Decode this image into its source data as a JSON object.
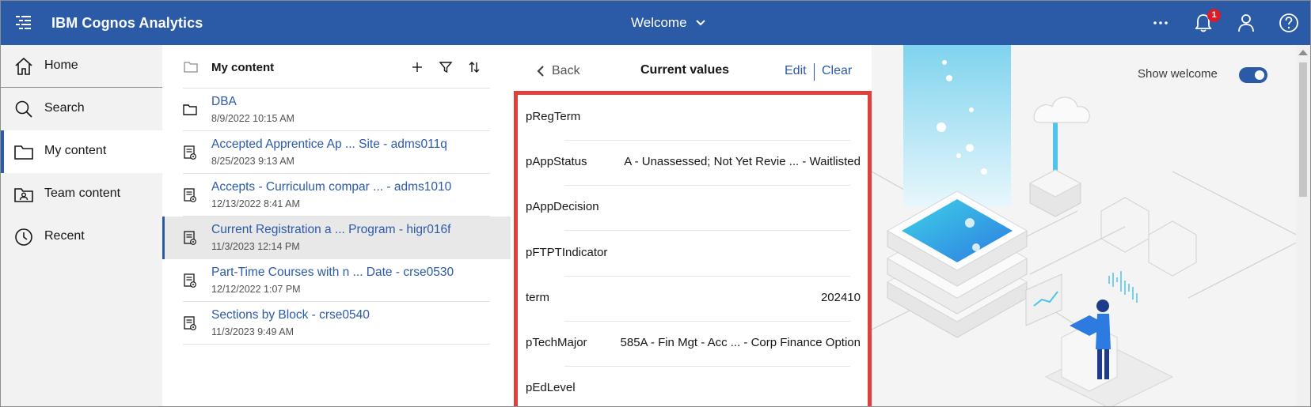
{
  "header": {
    "app_title": "IBM Cognos Analytics",
    "welcome_label": "Welcome",
    "notification_count": "1",
    "brand_color": "#2b5aa6"
  },
  "sidebar": {
    "items": [
      {
        "label": "Home",
        "icon": "home-icon"
      },
      {
        "label": "Search",
        "icon": "search-icon"
      },
      {
        "label": "My content",
        "icon": "folder-icon",
        "active": true
      },
      {
        "label": "Team content",
        "icon": "team-folder-icon"
      },
      {
        "label": "Recent",
        "icon": "clock-icon"
      }
    ]
  },
  "content": {
    "title": "My content",
    "items": [
      {
        "name": "DBA",
        "date": "8/9/2022 10:15 AM",
        "type": "folder"
      },
      {
        "name": "Accepted Apprentice Ap ... Site - adms011q",
        "date": "8/25/2023 9:13 AM",
        "type": "report"
      },
      {
        "name": "Accepts - Curriculum compar ... - adms1010",
        "date": "12/13/2022 8:41 AM",
        "type": "report"
      },
      {
        "name": "Current Registration a ... Program - higr016f",
        "date": "11/3/2023 12:14 PM",
        "type": "report",
        "selected": true
      },
      {
        "name": "Part-Time Courses with n ... Date - crse0530",
        "date": "12/12/2022 1:07 PM",
        "type": "report"
      },
      {
        "name": "Sections by Block - crse0540",
        "date": "11/3/2023 9:49 AM",
        "type": "report"
      }
    ]
  },
  "current_values": {
    "back_label": "Back",
    "title": "Current values",
    "edit_label": "Edit",
    "clear_label": "Clear",
    "highlight_color": "#e0403c",
    "params": [
      {
        "name": "pRegTerm",
        "value": ""
      },
      {
        "name": "pAppStatus",
        "value": "A - Unassessed; Not Yet Revie ... - Waitlisted"
      },
      {
        "name": "pAppDecision",
        "value": ""
      },
      {
        "name": "pFTPTIndicator",
        "value": ""
      },
      {
        "name": "term",
        "value": "202410"
      },
      {
        "name": "pTechMajor",
        "value": "585A - Fin Mgt - Acc ... - Corp Finance Option"
      },
      {
        "name": "pEdLevel",
        "value": ""
      }
    ]
  },
  "welcome_panel": {
    "show_welcome_label": "Show welcome",
    "show_welcome_on": true
  }
}
